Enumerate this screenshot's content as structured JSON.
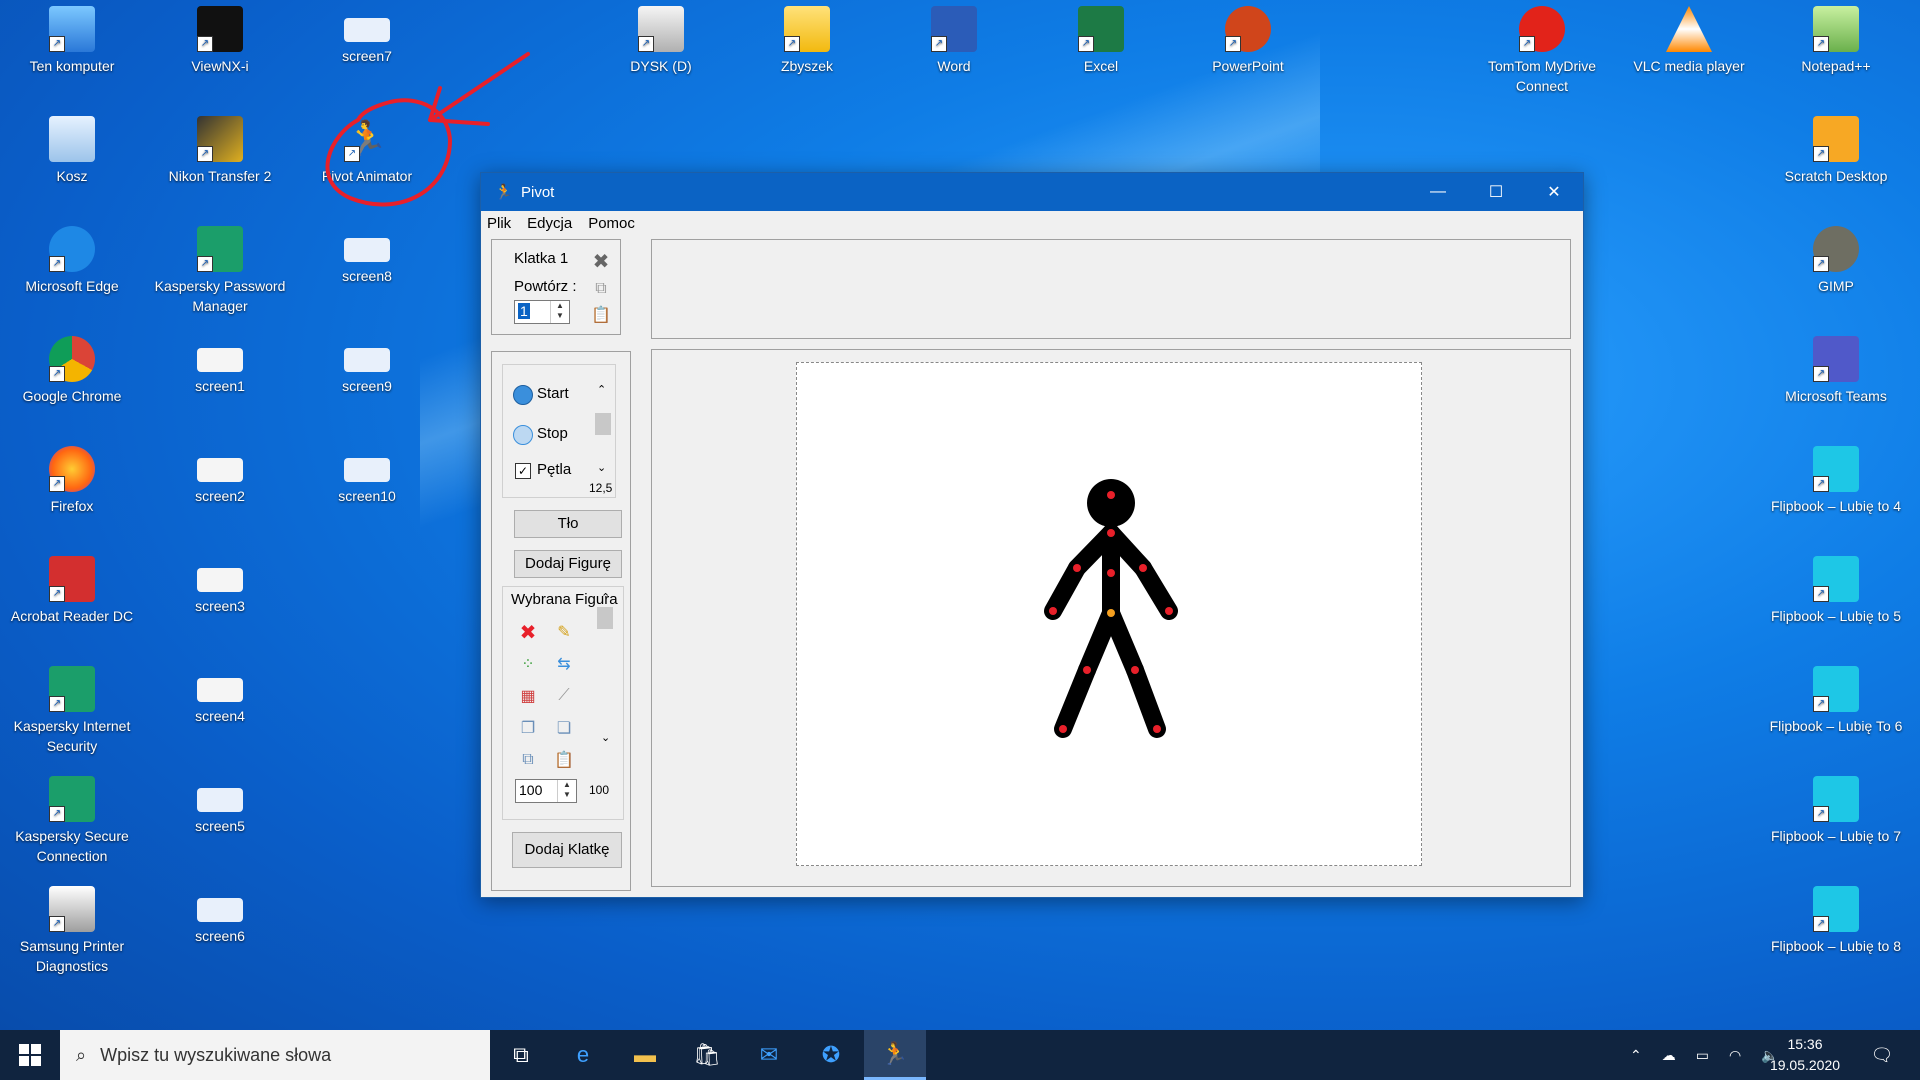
{
  "desktop": {
    "icons": [
      {
        "label": "Ten komputer"
      },
      {
        "label": "ViewNX-i"
      },
      {
        "label": "screen7"
      },
      {
        "label": "DYSK (D)"
      },
      {
        "label": "Zbyszek"
      },
      {
        "label": "Word"
      },
      {
        "label": "Excel"
      },
      {
        "label": "PowerPoint"
      },
      {
        "label": "TomTom MyDrive Connect"
      },
      {
        "label": "VLC media player"
      },
      {
        "label": "Notepad++"
      },
      {
        "label": "Kosz"
      },
      {
        "label": "Nikon Transfer 2"
      },
      {
        "label": "Pivot Animator"
      },
      {
        "label": "Scratch Desktop"
      },
      {
        "label": "Microsoft Edge"
      },
      {
        "label": "Kaspersky Password Manager"
      },
      {
        "label": "screen8"
      },
      {
        "label": "GIMP"
      },
      {
        "label": "Google Chrome"
      },
      {
        "label": "screen1"
      },
      {
        "label": "screen9"
      },
      {
        "label": "Microsoft Teams"
      },
      {
        "label": "Firefox"
      },
      {
        "label": "screen2"
      },
      {
        "label": "screen10"
      },
      {
        "label": "Flipbook – Lubię to 4"
      },
      {
        "label": "Acrobat Reader DC"
      },
      {
        "label": "screen3"
      },
      {
        "label": "Flipbook – Lubię to 5"
      },
      {
        "label": "Kaspersky Internet Security"
      },
      {
        "label": "screen4"
      },
      {
        "label": "Flipbook – Lubię To 6"
      },
      {
        "label": "Kaspersky Secure Connection"
      },
      {
        "label": "screen5"
      },
      {
        "label": "Flipbook – Lubię to 7"
      },
      {
        "label": "Samsung Printer Diagnostics"
      },
      {
        "label": "screen6"
      },
      {
        "label": "Flipbook – Lubię to 8"
      }
    ]
  },
  "window": {
    "title": "Pivot",
    "menu": [
      "Plik",
      "Edycja",
      "Pomoc"
    ],
    "frame_label": "Klatka 1",
    "repeat_label": "Powtórz :",
    "repeat_value": "1",
    "start_label": "Start",
    "stop_label": "Stop",
    "loop_label": "Pętla",
    "speed_value": "12,5",
    "background_button": "Tło",
    "add_figure_button": "Dodaj Figurę",
    "selected_figure_label": "Wybrana Figura",
    "size_value": "100",
    "size_readout": "100",
    "add_frame_button": "Dodaj Klatkę"
  },
  "taskbar": {
    "search_placeholder": "Wpisz tu wyszukiwane słowa",
    "time": "15:36",
    "date": "19.05.2020"
  },
  "colors": {
    "annotation": "#e8202a",
    "joint_red": "#e8202a",
    "joint_orange": "#f5a020",
    "titlebar": "#0b63c4"
  }
}
